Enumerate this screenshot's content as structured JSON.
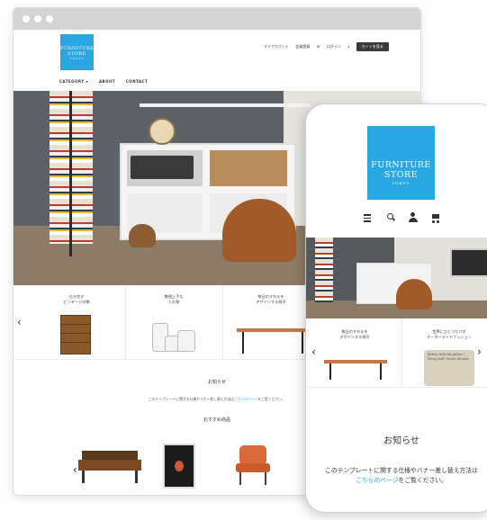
{
  "brand": {
    "line1": "FURNITURE",
    "line2": "STORE",
    "line3": "TOKYO",
    "color": "#2aa7e2"
  },
  "desktop": {
    "util": {
      "account": "マイアカウント",
      "register": "会員登録",
      "or": "or",
      "login": "ログイン",
      "cart": "カートを見る"
    },
    "nav": {
      "category": "CATEGORY ▾",
      "about": "ABOUT",
      "contact": "CONTACT"
    },
    "categories": [
      {
        "line1": "古き良き",
        "line2": "ビンテージの棚"
      },
      {
        "line1": "整理上手な",
        "line2": "入れ物"
      },
      {
        "line1": "毎日のすわるを",
        "line2": "デザインする椅子"
      }
    ],
    "arrow_prev": "‹",
    "news": {
      "title": "お知らせ",
      "text_before": "このテンプレートに関する仕様やバナー差し替え方法は",
      "link": "こちらのページ",
      "text_after": "をご覧ください。"
    },
    "recommended": {
      "title": "おすすめ商品"
    }
  },
  "mobile": {
    "categories": [
      {
        "line1": "毎日のすわるを",
        "line2": "デザインする椅子"
      },
      {
        "line1": "世界にひとつだけの",
        "line2": "オーダーメイドクッション"
      }
    ],
    "pillow_text": "Better with the pillow / Sleep well, Sweet dreams",
    "arrow_prev": "‹",
    "arrow_next": "›",
    "news": {
      "title": "お知らせ",
      "text_before": "このテンプレートに関する仕様やバナー差し替え方法は",
      "link": "こちらのページ",
      "text_after": "をご覧ください。"
    }
  }
}
